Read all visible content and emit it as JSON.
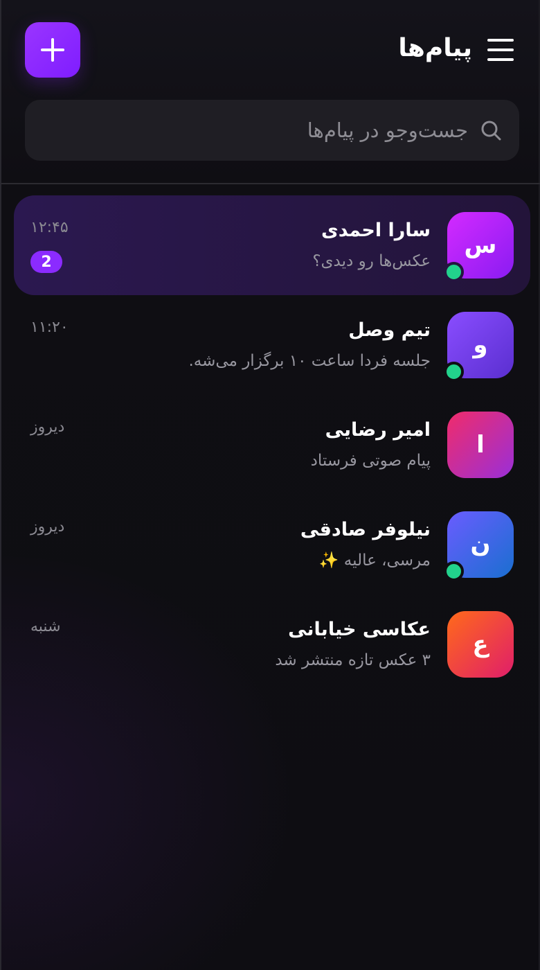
{
  "header": {
    "title": "پیام‌ها",
    "menu_icon": "hamburger-menu-icon",
    "compose_icon": "plus-icon"
  },
  "search": {
    "placeholder": "جست‌وجو در پیام‌ها",
    "value": ""
  },
  "colors": {
    "accent": "#8b2bff",
    "online": "#22d28c",
    "active_row": "#2b1850"
  },
  "conversations": [
    {
      "initial": "س",
      "name": "سارا احمدی",
      "preview": "عکس‌ها رو دیدی؟",
      "time": "۱۲:۴۵",
      "unread": "2",
      "online": true,
      "active": true,
      "avatar_gradient": [
        "#d42aff",
        "#8a1cf2"
      ]
    },
    {
      "initial": "و",
      "name": "تیم وصل",
      "preview": "جلسه فردا ساعت ۱۰ برگزار می‌شه.",
      "time": "۱۱:۲۰",
      "unread": "",
      "online": true,
      "active": false,
      "avatar_gradient": [
        "#8a4dff",
        "#5a2fd0"
      ]
    },
    {
      "initial": "ا",
      "name": "امیر رضایی",
      "preview": "پیام صوتی فرستاد",
      "time": "دیروز",
      "unread": "",
      "online": false,
      "active": false,
      "avatar_gradient": [
        "#f02c6a",
        "#9a2fd8"
      ]
    },
    {
      "initial": "ن",
      "name": "نیلوفر صادقی",
      "preview": "مرسی، عالیه ✨",
      "time": "دیروز",
      "unread": "",
      "online": true,
      "active": false,
      "avatar_gradient": [
        "#6a5cff",
        "#1a6fd0"
      ]
    },
    {
      "initial": "ع",
      "name": "عکاسی خیابانی",
      "preview": "۳ عکس تازه منتشر شد",
      "time": "شنبه",
      "unread": "",
      "online": false,
      "active": false,
      "avatar_gradient": [
        "#ff6a1a",
        "#e01e6a"
      ]
    }
  ]
}
